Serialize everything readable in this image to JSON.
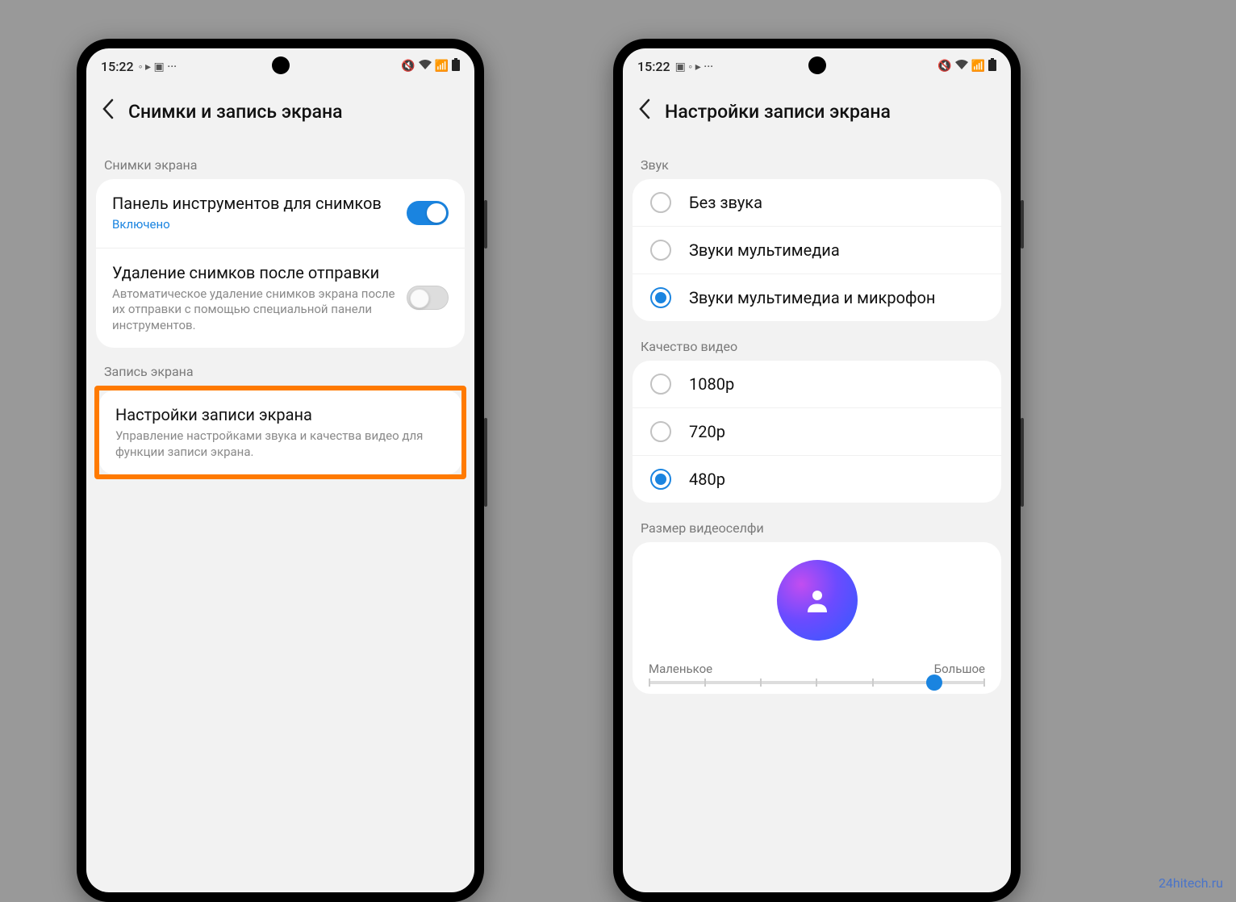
{
  "watermark": "24hitech.ru",
  "status": {
    "time": "15:22",
    "left_icons": "◦ ▸ ▣ ···",
    "left_icons2": "▣ ◦ ▸ ···",
    "right_icons": "✕ 📶 ▮"
  },
  "left": {
    "title": "Снимки и запись экрана",
    "section1": "Снимки экрана",
    "row1_title": "Панель инструментов для снимков",
    "row1_sub": "Включено",
    "row2_title": "Удаление снимков после отправки",
    "row2_sub": "Автоматическое удаление снимков экрана после их отправки с помощью специальной панели инструментов.",
    "section2": "Запись экрана",
    "row3_title": "Настройки записи экрана",
    "row3_sub": "Управление настройками звука и качества видео для функции записи экрана."
  },
  "right": {
    "title": "Настройки записи экрана",
    "section1": "Звук",
    "sound_options": [
      {
        "label": "Без звука",
        "checked": false
      },
      {
        "label": "Звуки мультимедиа",
        "checked": false
      },
      {
        "label": "Звуки мультимедиа и микрофон",
        "checked": true
      }
    ],
    "section2": "Качество видео",
    "quality_options": [
      {
        "label": "1080p",
        "checked": false
      },
      {
        "label": "720p",
        "checked": false
      },
      {
        "label": "480p",
        "checked": true
      }
    ],
    "section3": "Размер видеоселфи",
    "slider_min": "Маленькое",
    "slider_max": "Большое",
    "slider_pos_pct": 85
  }
}
